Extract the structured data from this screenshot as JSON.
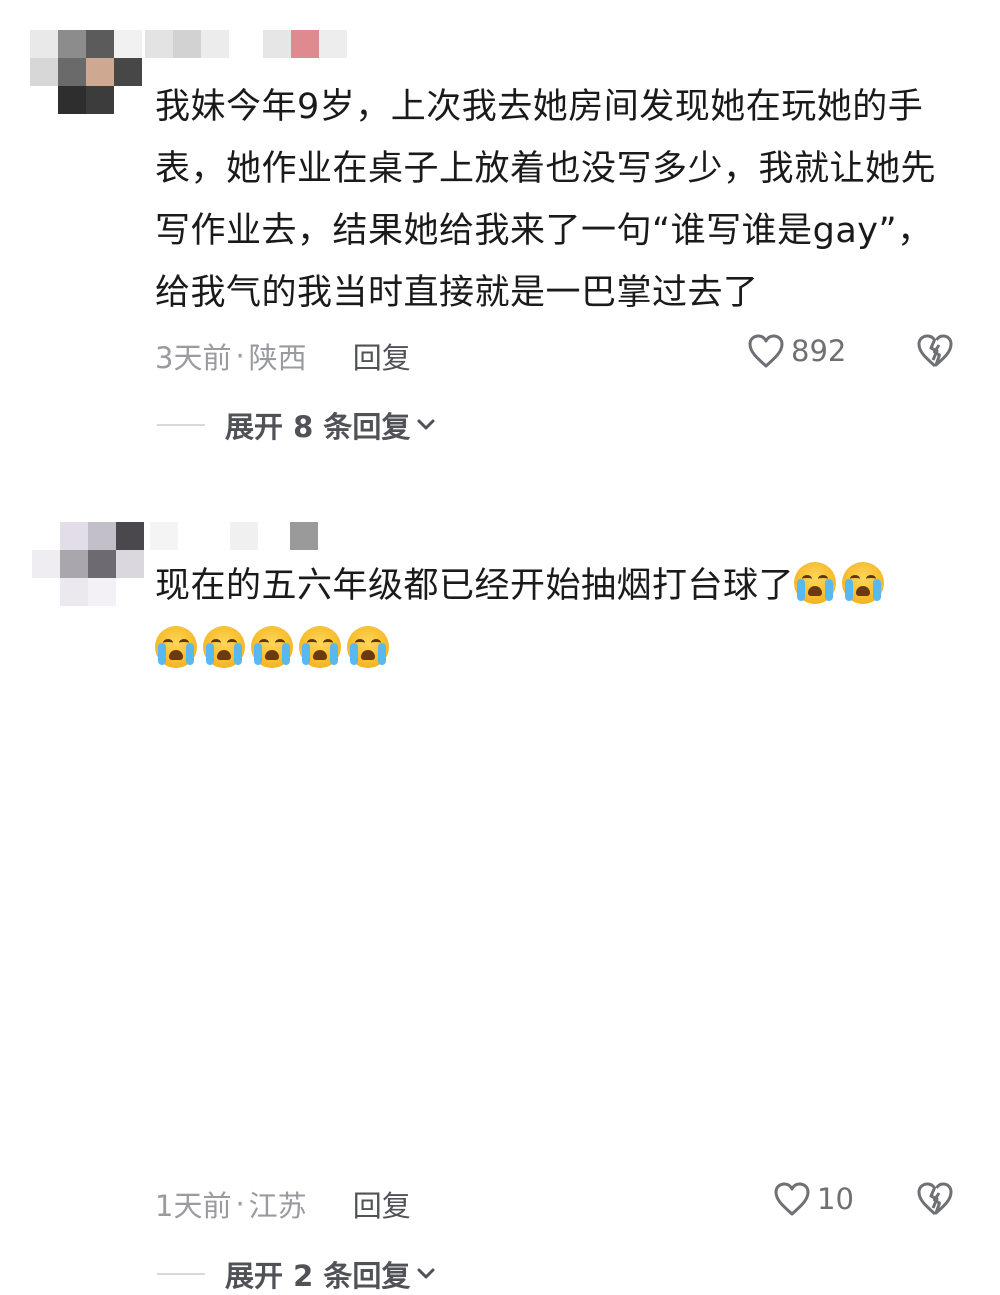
{
  "comments": [
    {
      "text": "我妹今年9岁，上次我去她房间发现她在玩她的手表，她作业在桌子上放着也没写多少，我就让她先写作业去，结果她给我来了一句“谁写谁是gay”，给我气的我当时直接就是一巴掌过去了",
      "time": "3天前",
      "separator": "·",
      "location": "陕西",
      "reply_label": "回复",
      "likes": "892",
      "expand_label": "展开 8 条回复",
      "emojis": []
    },
    {
      "text": "现在的五六年级都已经开始抽烟打台球了",
      "time": "1天前",
      "separator": "·",
      "location": "江苏",
      "reply_label": "回复",
      "likes": "10",
      "expand_label": "展开 2 条回复",
      "emojis": [
        "loudly-crying-face",
        "loudly-crying-face",
        "loudly-crying-face",
        "loudly-crying-face",
        "loudly-crying-face",
        "loudly-crying-face",
        "loudly-crying-face"
      ]
    }
  ],
  "icons": {
    "like": "heart-outline-icon",
    "dislike": "broken-heart-icon",
    "expand": "chevron-down-icon"
  },
  "colors": {
    "text": "#1a1a1a",
    "meta": "#9a9ba0",
    "action": "#505258"
  }
}
